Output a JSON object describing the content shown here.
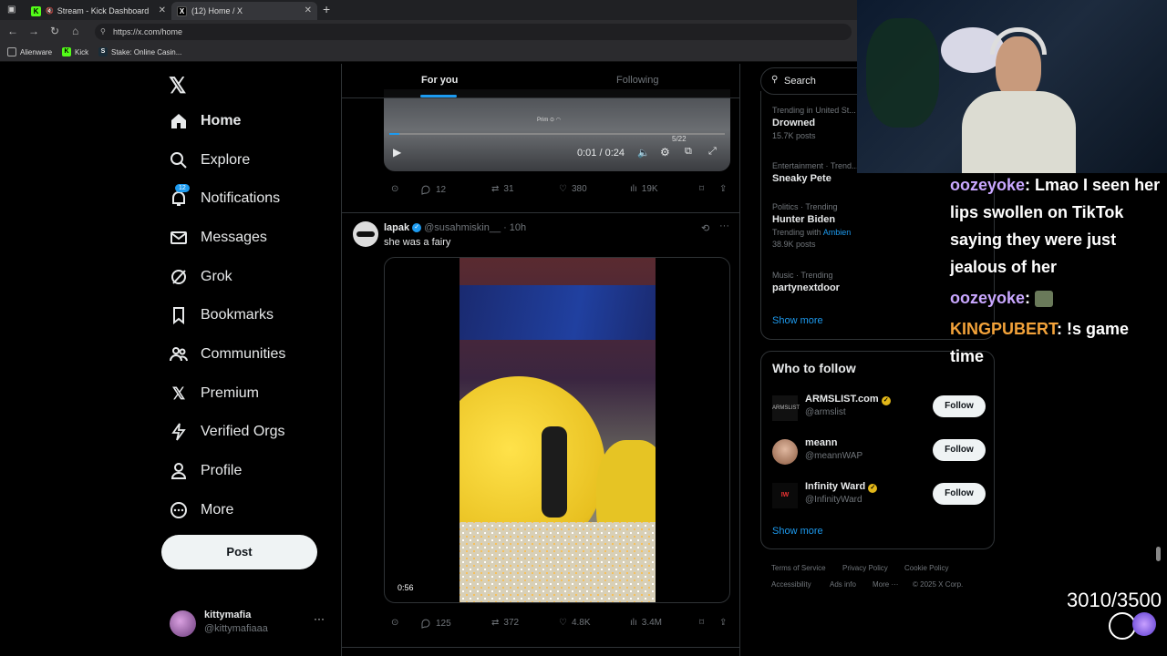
{
  "browser": {
    "tabs": [
      {
        "title": "Stream - Kick Dashboard"
      },
      {
        "title": "(12) Home / X"
      }
    ],
    "url": "https://x.com/home",
    "bookmarks": [
      "Alienware",
      "Kick",
      "Stake: Online Casin..."
    ]
  },
  "nav": {
    "items": [
      {
        "label": "Home",
        "icon": "home-icon"
      },
      {
        "label": "Explore",
        "icon": "search-icon"
      },
      {
        "label": "Notifications",
        "icon": "bell-icon",
        "badge": "12"
      },
      {
        "label": "Messages",
        "icon": "mail-icon"
      },
      {
        "label": "Grok",
        "icon": "grok-icon"
      },
      {
        "label": "Bookmarks",
        "icon": "bookmark-icon"
      },
      {
        "label": "Communities",
        "icon": "people-icon"
      },
      {
        "label": "Premium",
        "icon": "x-icon"
      },
      {
        "label": "Verified Orgs",
        "icon": "bolt-icon"
      },
      {
        "label": "Profile",
        "icon": "person-icon"
      },
      {
        "label": "More",
        "icon": "more-circle-icon"
      }
    ],
    "post_label": "Post",
    "account": {
      "name": "kittymafia",
      "handle": "@kittymafiaaa"
    }
  },
  "feed": {
    "tabs": [
      "For you",
      "Following"
    ],
    "video1": {
      "time": "0:01 / 0:24",
      "hud_text": "5/22"
    },
    "post1_actions": {
      "replies": "12",
      "reposts": "31",
      "likes": "380",
      "views": "19K"
    },
    "post2": {
      "name": "lapak",
      "handle": "@susahmiskin__",
      "time": "10h",
      "text": "she was a fairy",
      "video_duration": "0:56",
      "actions": {
        "replies": "125",
        "reposts": "372",
        "likes": "4.8K",
        "views": "3.4M"
      }
    }
  },
  "sidebar": {
    "search_placeholder": "Search",
    "trends": [
      {
        "category": "Trending in United St...",
        "name": "Drowned",
        "count": "15.7K posts"
      },
      {
        "category": "Entertainment · Trend...",
        "name": "Sneaky Pete",
        "count": ""
      },
      {
        "category": "Politics · Trending",
        "name": "Hunter Biden",
        "with_label": "Trending with",
        "with_link": "Ambien",
        "count": "38.9K posts"
      },
      {
        "category": "Music · Trending",
        "name": "partynextdoor",
        "count": ""
      }
    ],
    "show_more": "Show more",
    "who_to_follow_title": "Who to follow",
    "who_to_follow": [
      {
        "name": "ARMSLIST.com",
        "handle": "@armslist",
        "button": "Follow"
      },
      {
        "name": "meann",
        "handle": "@meannWAP",
        "button": "Follow"
      },
      {
        "name": "Infinity Ward",
        "handle": "@InfinityWard",
        "button": "Follow"
      }
    ],
    "show_more2": "Show more",
    "footer": [
      "Terms of Service",
      "Privacy Policy",
      "Cookie Policy",
      "Accessibility",
      "Ads info",
      "More ···",
      "© 2025 X Corp."
    ]
  },
  "chat": [
    {
      "user": "oozeyoke",
      "sep": ": ",
      "msg": "Lmao I seen her lips swollen on TikTok saying they were just jealous of her"
    },
    {
      "user": "oozeyoke",
      "sep": ": ",
      "msg": ""
    },
    {
      "user": "KINGPUBERT",
      "sep": ": ",
      "msg": "!s game time"
    }
  ],
  "counter": "3010/3500",
  "colors": {
    "accent": "#1d9bf0",
    "chat_user1": "#c9a7ff",
    "chat_user2": "#f2a23a"
  }
}
